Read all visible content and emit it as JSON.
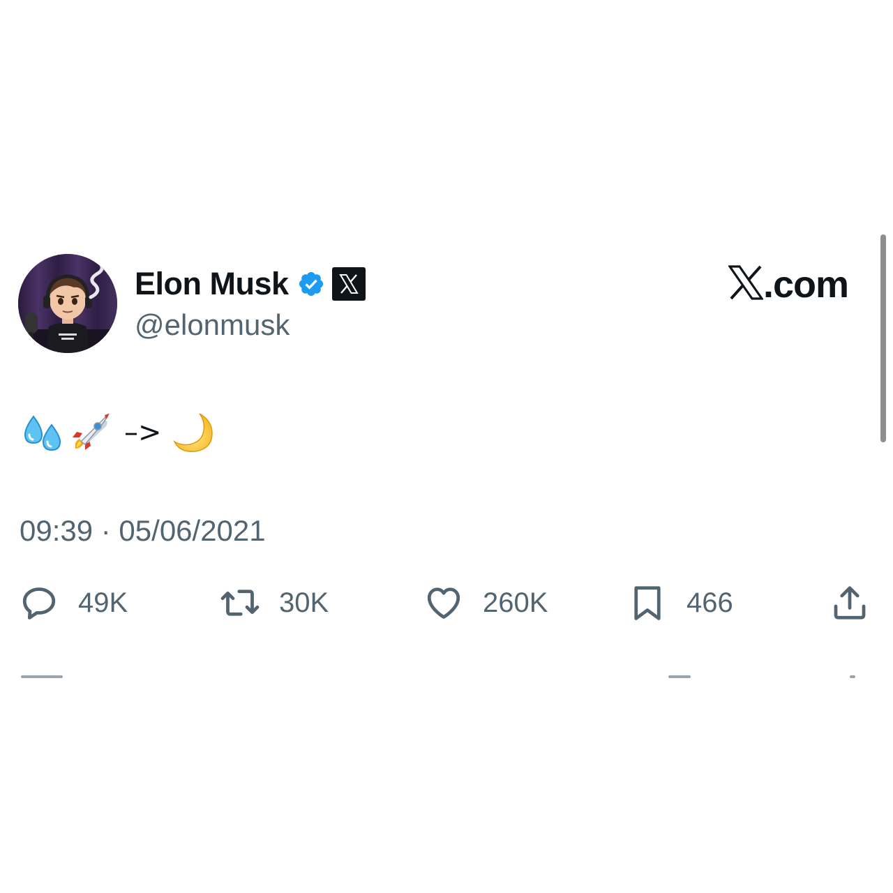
{
  "author": {
    "display_name": "Elon Musk",
    "handle": "@elonmusk",
    "verified_icon": "verified-badge-icon",
    "affiliate_icon": "x-affiliate-icon"
  },
  "brand": {
    "label": ".com",
    "mark_icon": "x-logo-icon"
  },
  "post": {
    "content_icons": [
      "sweat-droplets-emoji",
      "rocket-emoji",
      "crescent-moon-emoji"
    ],
    "arrow_text": "–>",
    "timestamp": "09:39 · 05/06/2021"
  },
  "actions": {
    "replies": "49K",
    "reposts": "30K",
    "likes": "260K",
    "bookmarks": "466"
  },
  "colors": {
    "text_primary": "#0f1419",
    "text_secondary": "#536471",
    "verified_blue": "#1d9bf0"
  }
}
